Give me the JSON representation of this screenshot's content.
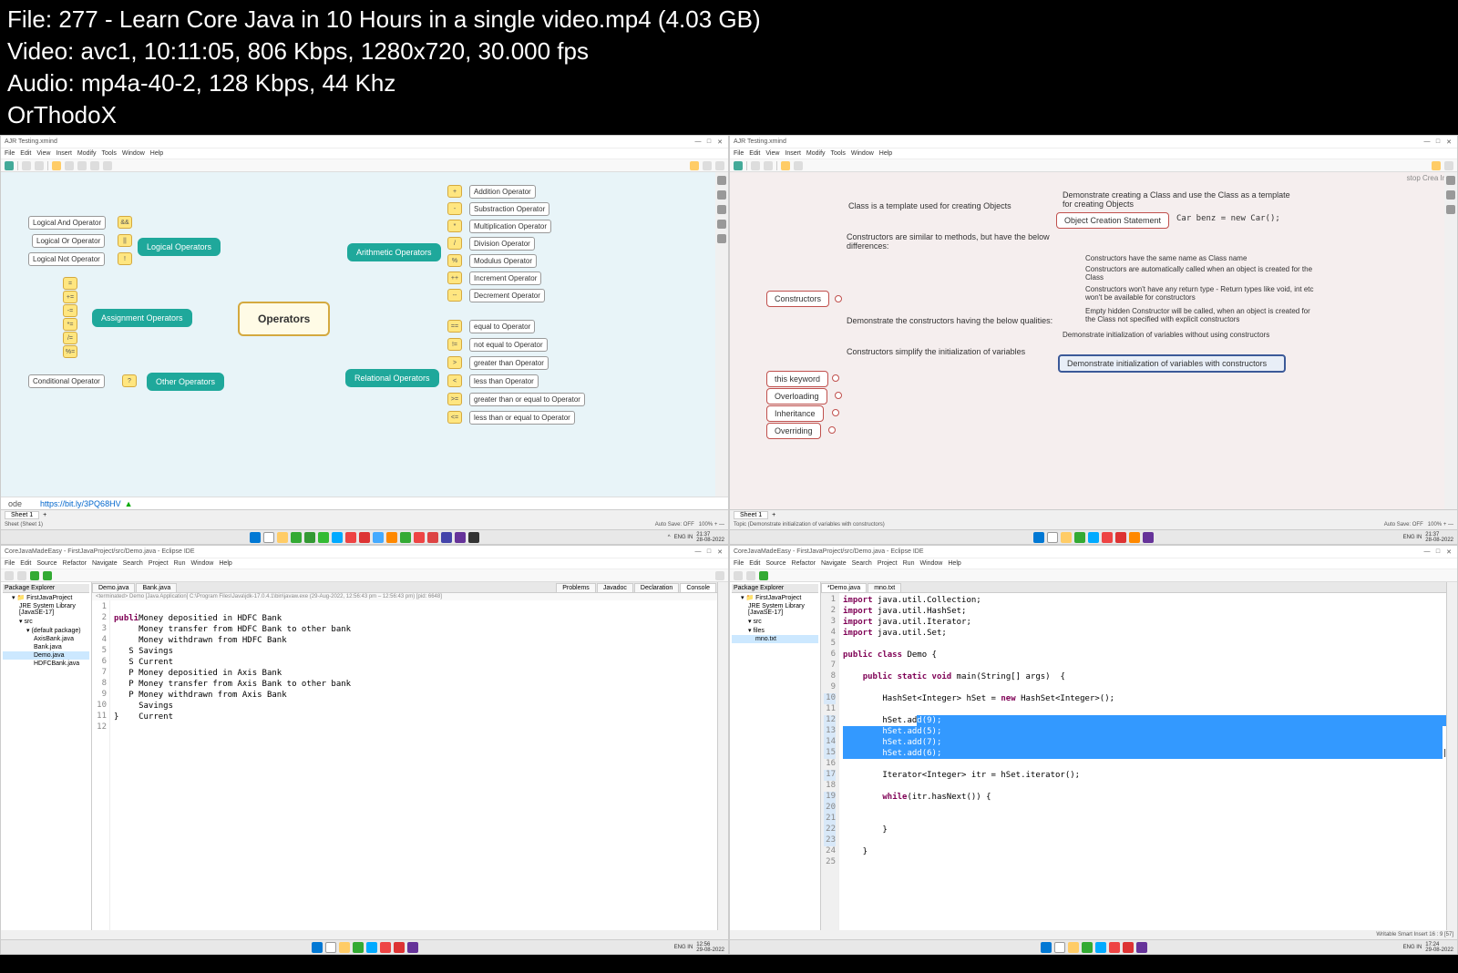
{
  "overlay": {
    "file": "File: 277 - Learn Core Java in 10 Hours in a single video.mp4 (4.03 GB)",
    "video": "Video: avc1, 10:11:05, 806 Kbps, 1280x720, 30.000 fps",
    "audio": "Audio: mp4a-40-2, 128 Kbps, 44 Khz",
    "tag": "OrThodoX"
  },
  "xmind": {
    "title": "AJR Testing.xmind",
    "menu": [
      "File",
      "Edit",
      "View",
      "Insert",
      "Modify",
      "Tools",
      "Window",
      "Help"
    ],
    "tab": "AJR Testing",
    "sheet": "Sheet 1",
    "sheet_status": "Sheet (Sheet 1)",
    "autosave": "Auto Save: OFF",
    "zoom": "100%",
    "url_prefix": "ode",
    "url": "https://bit.ly/3PQ68HV"
  },
  "operators": {
    "central": "Operators",
    "branches": {
      "logical": {
        "label": "Logical Operators",
        "items": [
          "Logical And Operator",
          "Logical Or Operator",
          "Logical Not Operator"
        ],
        "badges": [
          "&&",
          "||",
          "!"
        ]
      },
      "assignment": {
        "label": "Assignment Operators",
        "badges": [
          "=",
          "+=",
          "-=",
          "*=",
          "/=",
          "%="
        ]
      },
      "other": {
        "label": "Other Operators",
        "item": "Conditional Operator",
        "badge": "?"
      },
      "arithmetic": {
        "label": "Arithmetic Operators",
        "items": [
          "Addition Operator",
          "Substraction Operator",
          "Multiplication Operator",
          "Division Operator",
          "Modulus Operator",
          "Increment Operator",
          "Decrement Operator"
        ],
        "badges": [
          "+",
          "-",
          "*",
          "/",
          "%",
          "++",
          "--"
        ]
      },
      "relational": {
        "label": "Relational Operators",
        "items": [
          "equal to Operator",
          "not equal to Operator",
          "greater than Operator",
          "less than Operator",
          "greater than or equal to Operator",
          "less than or equal to Operator"
        ],
        "badges": [
          "==",
          "!=",
          ">",
          "<",
          ">=",
          "<="
        ]
      }
    }
  },
  "constructors": {
    "top_right": "stop   Crea   Initi",
    "class_text": "Class is a template used for creating Objects",
    "demo_class": "Demonstrate creating a Class and use the Class as a template for creating Objects",
    "obj_stmt": "Object Creation Statement",
    "car_code": "Car benz = new Car();",
    "ctors": "Constructors",
    "similar": "Constructors are similar to methods, but have the below differences:",
    "qualities_label": "Demonstrate the constructors having the below qualities:",
    "qualities": [
      "Constructors have the same name as Class name",
      "Constructors are automatically called when an object is created for the Class",
      "Constructors won't have any return type - Return types like void, int etc won't be available for constructors",
      "Empty hidden Constructor will be called, when an object is created for the Class not specified with explicit constructors"
    ],
    "simplify": "Constructors simplify the initialization of variables",
    "demo_without": "Demonstrate initialization of variables without using constructors",
    "demo_with": "Demonstrate initialization of variables with constructors",
    "this_kw": "this keyword",
    "overloading": "Overloading",
    "inheritance": "Inheritance",
    "overriding": "Overriding",
    "status_topic": "Topic (Demonstrate initialization of variables with constructors)"
  },
  "eclipse": {
    "title": "CoreJavaMadeEasy - FirstJavaProject/src/Demo.java - Eclipse IDE",
    "menu": [
      "File",
      "Edit",
      "Source",
      "Refactor",
      "Navigate",
      "Search",
      "Project",
      "Run",
      "Window",
      "Help"
    ],
    "pkg_header": "Package Explorer",
    "project": "FirstJavaProject",
    "jre": "JRE System Library [JavaSE-17]",
    "src": "src",
    "pkg": "(default package)",
    "files_left": [
      "AxisBank.java",
      "Bank.java",
      "Demo.java",
      "HDFCBank.java"
    ],
    "files_right": [
      "files",
      "mno.txt"
    ],
    "tabs_left": [
      "Demo.java",
      "Bank.java"
    ],
    "console_tabs": [
      "Problems",
      "Javadoc",
      "Declaration",
      "Console"
    ],
    "terminated": "<terminated> Demo [Java Application] C:\\Program Files\\Java\\jdk-17.0.4.1\\bin\\javaw.exe  (29-Aug-2022, 12:56:43 pm – 12:56:43 pm) [pid: 6648]",
    "tabs_right": [
      "Demo.java",
      "mno.txt"
    ]
  },
  "console_output": [
    "Money depositied in HDFC Bank",
    "Money transfer from HDFC Bank to other bank",
    "Money withdrawn from HDFC Bank",
    "Savings",
    "Current",
    "Money depositied in Axis Bank",
    "Money transfer from Axis Bank to other bank",
    "Money withdrawn from Axis Bank",
    "Savings",
    "Current"
  ],
  "code_left": {
    "lines": [
      "1",
      "2",
      "3",
      "4",
      "5",
      "6",
      "7",
      "8",
      "9",
      "10",
      "11",
      "12"
    ],
    "visible": "publi"
  },
  "code_right": {
    "imports": [
      "import java.util.Collection;",
      "import java.util.HashSet;",
      "import java.util.Iterator;",
      "import java.util.Set;"
    ],
    "class_decl": "public class Demo {",
    "main": "    public static void main(String[] args)  {",
    "hset_decl": "        HashSet<Integer> hSet = new HashSet<Integer>();",
    "adds": [
      "        hSet.add(9);",
      "        hSet.add(5);",
      "        hSet.add(7);",
      "        hSet.add(6);"
    ],
    "itr": "        Iterator<Integer> itr = hSet.iterator();",
    "while": "        while(itr.hasNext()) {",
    "close1": "        }",
    "lines": [
      "1",
      "2",
      "3",
      "4",
      "5",
      "6",
      "7",
      "8",
      "9",
      "10",
      "11",
      "12",
      "13",
      "14",
      "15",
      "16",
      "17",
      "18",
      "19",
      "20",
      "21",
      "22",
      "23",
      "24",
      "25"
    ]
  },
  "taskbar": {
    "time1": "12:56",
    "date1": "29-08-2022",
    "time2": "21:37",
    "date2": "28-08-2022",
    "time3": "12:56",
    "date3": "29-08-2022",
    "time4": "17:24",
    "date4": "29-08-2022",
    "lang": "ENG IN",
    "status_right": "Writable       Smart Insert       16 : 9 [57]"
  }
}
